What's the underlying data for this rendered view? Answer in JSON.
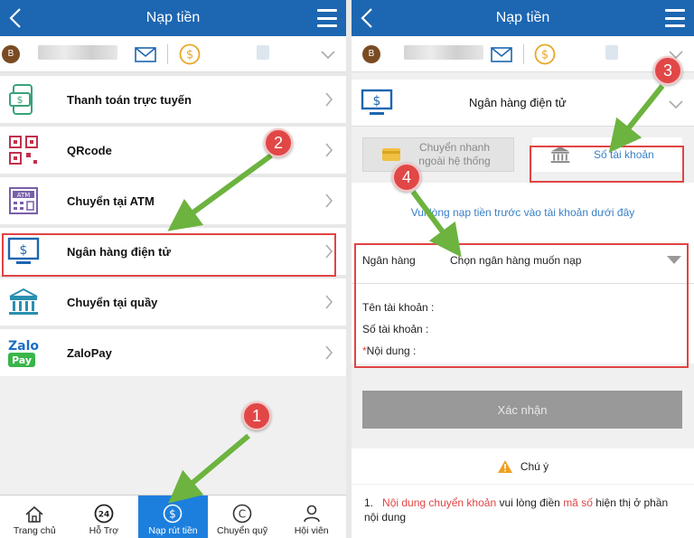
{
  "left": {
    "header": {
      "title": "Nạp tiền"
    },
    "user": {
      "avatar_letter": "B"
    },
    "menu_items": [
      {
        "label": "Thanh toán trực tuyến",
        "icon": "online-payment-icon"
      },
      {
        "label": "QRcode",
        "icon": "qrcode-icon"
      },
      {
        "label": "Chuyển tại ATM",
        "icon": "atm-icon"
      },
      {
        "label": "Ngân hàng điện tử",
        "icon": "ebank-monitor-icon"
      },
      {
        "label": "Chuyển tại quầy",
        "icon": "bank-building-icon"
      },
      {
        "label": "ZaloPay",
        "icon": "zalopay-logo-icon"
      }
    ],
    "bottom_nav": [
      {
        "label": "Trang chủ",
        "icon": "home-icon"
      },
      {
        "label": "Hỗ Trợ",
        "icon": "support-24-icon"
      },
      {
        "label": "Nạp rút tiền",
        "icon": "deposit-coin-icon"
      },
      {
        "label": "Chuyển quỹ",
        "icon": "transfer-fund-icon"
      },
      {
        "label": "Hội viên",
        "icon": "member-icon"
      }
    ],
    "steps": [
      "1",
      "2"
    ]
  },
  "right": {
    "header": {
      "title": "Nạp tiền"
    },
    "user": {
      "avatar_letter": "B"
    },
    "section": {
      "label": "Ngân hàng điện tử"
    },
    "methods": {
      "fast": "Chuyển nhanh ngoài hệ thống",
      "account": "Số tài khoản"
    },
    "info": "Vui lòng nạp tiền trước vào tài khoản dưới đây",
    "bank": {
      "label": "Ngân hàng",
      "placeholder": "Chọn ngân hàng muốn nạp"
    },
    "details": {
      "account_name": "Tên tài khoản :",
      "account_number": "Số tài khoản :",
      "content_star": "*",
      "content": "Nội dung :"
    },
    "confirm": "Xác nhận",
    "note": {
      "title": "Chú ý",
      "num": "1.",
      "part1": "Nội dung chuyển khoản",
      "part2": " vui lòng điền ",
      "part3": "mã số",
      "part4": " hiện thị ở phần nội dung"
    },
    "steps": [
      "3",
      "4"
    ]
  },
  "colors": {
    "header": "#1d66b1",
    "active_nav": "#1d7fdd",
    "highlight": "#e04444",
    "arrow": "#6db33f",
    "link": "#3a80c6"
  }
}
